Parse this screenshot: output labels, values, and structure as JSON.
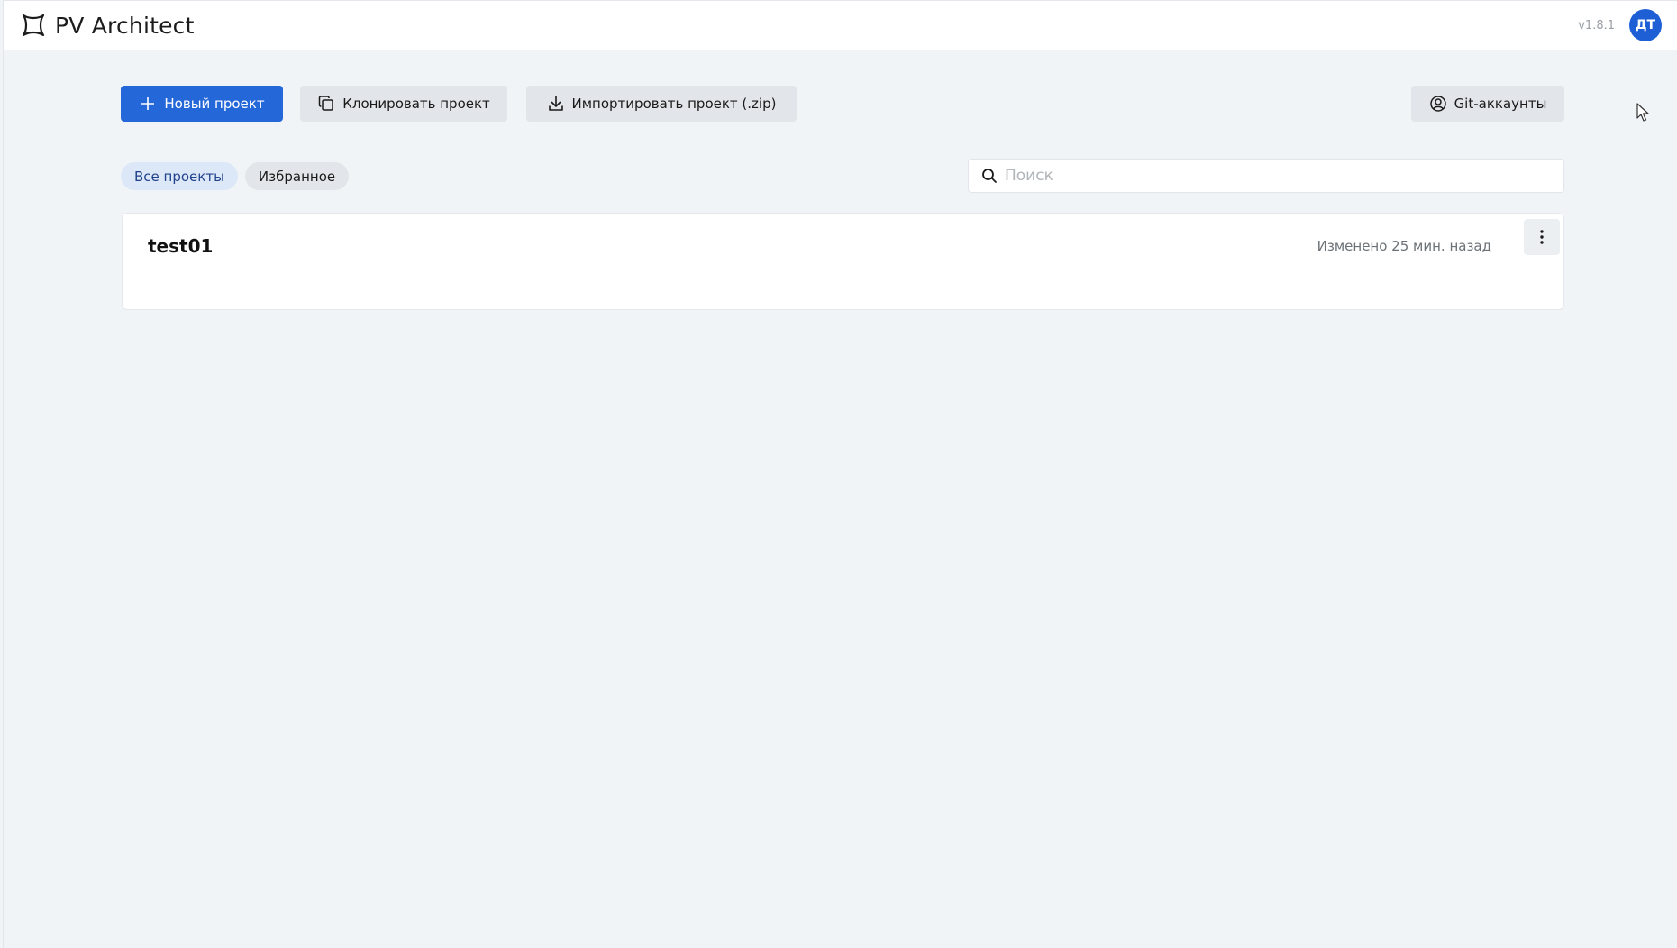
{
  "header": {
    "title": "PV Architect",
    "version": "v1.8.1",
    "avatar_initials": "ДТ",
    "logo_icon": "puzzle-frame-icon"
  },
  "toolbar": {
    "new_project_label": "Новый проект",
    "clone_project_label": "Клонировать проект",
    "import_project_label": "Импортировать проект (.zip)",
    "git_accounts_label": "Git-аккаунты"
  },
  "filters": {
    "all_projects": "Все проекты",
    "favorites": "Избранное",
    "active": "all_projects"
  },
  "search": {
    "placeholder": "Поиск",
    "value": ""
  },
  "projects": [
    {
      "name": "test01",
      "modified": "Изменено 25 мин. назад"
    }
  ],
  "colors": {
    "primary": "#2467d8",
    "avatar": "#1f5fd6",
    "background": "#f0f4f7",
    "chip_active_bg": "#dce7f8"
  }
}
